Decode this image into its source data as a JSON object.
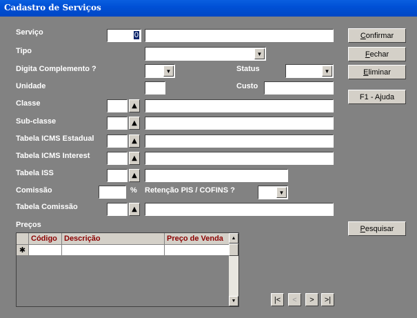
{
  "window": {
    "title": "Cadastro de Serviços"
  },
  "labels": {
    "servico": "Serviço",
    "tipo": "Tipo",
    "digita_complemento": "Digita Complemento ?",
    "status": "Status",
    "unidade": "Unidade",
    "custo": "Custo",
    "classe": "Classe",
    "subclasse": "Sub-classe",
    "icms_estadual": "Tabela ICMS Estadual",
    "icms_interest": "Tabela ICMS Interest",
    "iss": "Tabela ISS",
    "comissao": "Comissão",
    "percent": "%",
    "retencao": "Retenção PIS / COFINS ?",
    "tabela_comissao": "Tabela Comissão",
    "precos": "Preços"
  },
  "fields": {
    "servico_code": "0"
  },
  "buttons": {
    "confirmar_u": "C",
    "confirmar_rest": "onfirmar",
    "fechar_u": "F",
    "fechar_rest": "echar",
    "eliminar_u": "E",
    "eliminar_rest": "liminar",
    "ajuda": "F1 - Ajuda",
    "pesquisar_u": "P",
    "pesquisar_rest": "esquisar"
  },
  "grid": {
    "columns": [
      "Código",
      "Descrição",
      "Preço de Venda"
    ],
    "new_row_marker": "✱"
  },
  "nav": {
    "first": "|<",
    "prev": "<",
    "next": ">",
    "last": ">|"
  },
  "icons": {
    "dropdown": "▼",
    "lookup": "▲"
  }
}
